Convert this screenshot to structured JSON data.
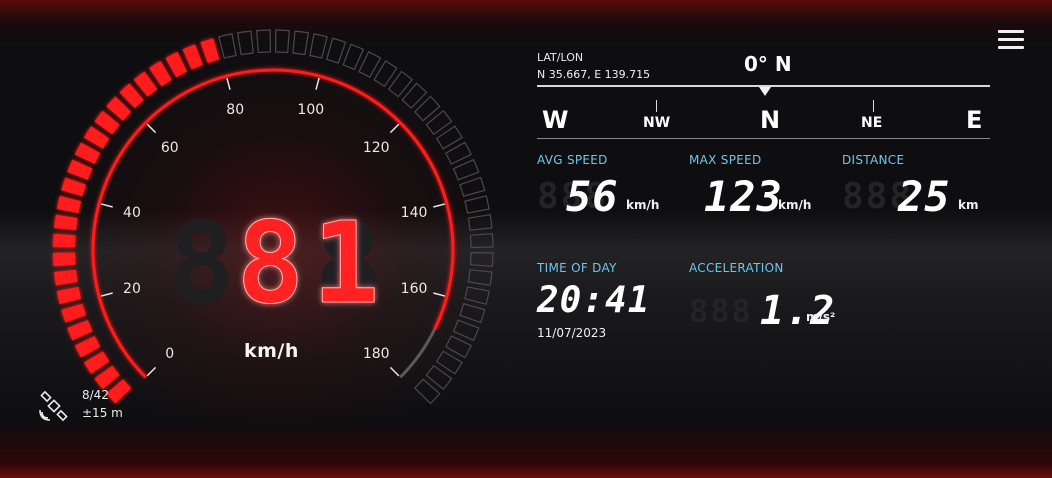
{
  "gauge": {
    "current_speed": "81",
    "speed_ghost": "888",
    "unit": "km/h",
    "max_scale": 180,
    "fill_fraction": 0.45,
    "scale_labels": [
      "0",
      "20",
      "40",
      "60",
      "80",
      "100",
      "120",
      "140",
      "160",
      "180"
    ],
    "accent_color": "#ff1a1a",
    "inactive_color": "#4a4a4a"
  },
  "menu": {
    "icon": "hamburger-menu-icon"
  },
  "location": {
    "label": "LAT/LON",
    "value": "N 35.667, E 139.715"
  },
  "compass": {
    "heading": "0° N",
    "directions": {
      "west": "W",
      "north_west": "NW",
      "north": "N",
      "north_east": "NE",
      "east": "E"
    }
  },
  "stats": {
    "avg_speed": {
      "label": "AVG SPEED",
      "ghost": "888",
      "value": "56",
      "unit": "km/h"
    },
    "max_speed": {
      "label": "MAX SPEED",
      "value": "123",
      "unit": "km/h"
    },
    "distance": {
      "label": "DISTANCE",
      "ghost": "888",
      "value": "25",
      "unit": "km"
    },
    "time_of_day": {
      "label": "TIME OF DAY",
      "value": "20:41",
      "date": "11/07/2023"
    },
    "acceleration": {
      "label": "ACCELERATION",
      "ghost": "888",
      "value": "1.2",
      "unit": "m/s²"
    }
  },
  "gps": {
    "icon": "satellite-icon",
    "satellites": "8/42",
    "accuracy": "±15 m"
  },
  "colors": {
    "label_blue": "#6fc6e6",
    "text_white": "#f2f2f2"
  }
}
